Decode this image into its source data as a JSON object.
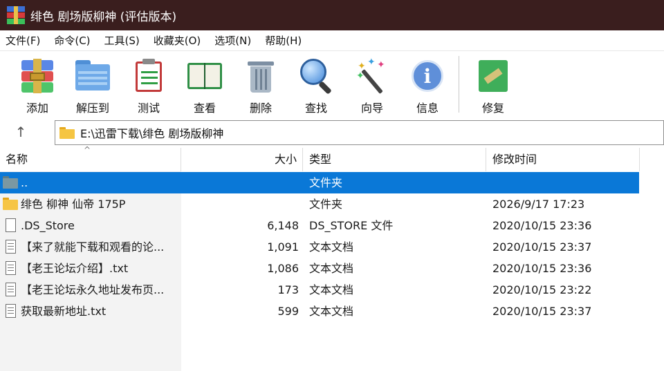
{
  "window": {
    "title": "绯色 剧场版柳神 (评估版本)"
  },
  "menu": [
    "文件(F)",
    "命令(C)",
    "工具(S)",
    "收藏夹(O)",
    "选项(N)",
    "帮助(H)"
  ],
  "toolbar": {
    "add": "添加",
    "extract": "解压到",
    "test": "测试",
    "view": "查看",
    "delete": "删除",
    "find": "查找",
    "wizard": "向导",
    "info": "信息",
    "repair": "修复"
  },
  "address": {
    "up_symbol": "↑",
    "path": "E:\\迅雷下载\\绯色 剧场版柳神"
  },
  "columns": {
    "name": "名称",
    "size": "大小",
    "type": "类型",
    "modified": "修改时间",
    "sort_symbol": "^"
  },
  "files": [
    {
      "name": "..",
      "size": "",
      "type": "文件夹",
      "modified": "",
      "icon": "parent-folder-icon",
      "selected": true
    },
    {
      "name": "绯色 柳神 仙帝 175P",
      "size": "",
      "type": "文件夹",
      "modified": "2026/9/17 17:23",
      "icon": "folder-icon",
      "selected": false
    },
    {
      "name": ".DS_Store",
      "size": "6,148",
      "type": "DS_STORE 文件",
      "modified": "2020/10/15 23:36",
      "icon": "file-icon",
      "selected": false
    },
    {
      "name": "【来了就能下载和观看的论...",
      "size": "1,091",
      "type": "文本文档",
      "modified": "2020/10/15 23:37",
      "icon": "text-file-icon",
      "selected": false
    },
    {
      "name": "【老王论坛介绍】.txt",
      "size": "1,086",
      "type": "文本文档",
      "modified": "2020/10/15 23:36",
      "icon": "text-file-icon",
      "selected": false
    },
    {
      "name": "【老王论坛永久地址发布页...",
      "size": "173",
      "type": "文本文档",
      "modified": "2020/10/15 23:22",
      "icon": "text-file-icon",
      "selected": false
    },
    {
      "name": "获取最新地址.txt",
      "size": "599",
      "type": "文本文档",
      "modified": "2020/10/15 23:37",
      "icon": "text-file-icon",
      "selected": false
    }
  ],
  "colors": {
    "titlebar_bg": "#3a1e1e",
    "selection_bg": "#0a78d7"
  }
}
